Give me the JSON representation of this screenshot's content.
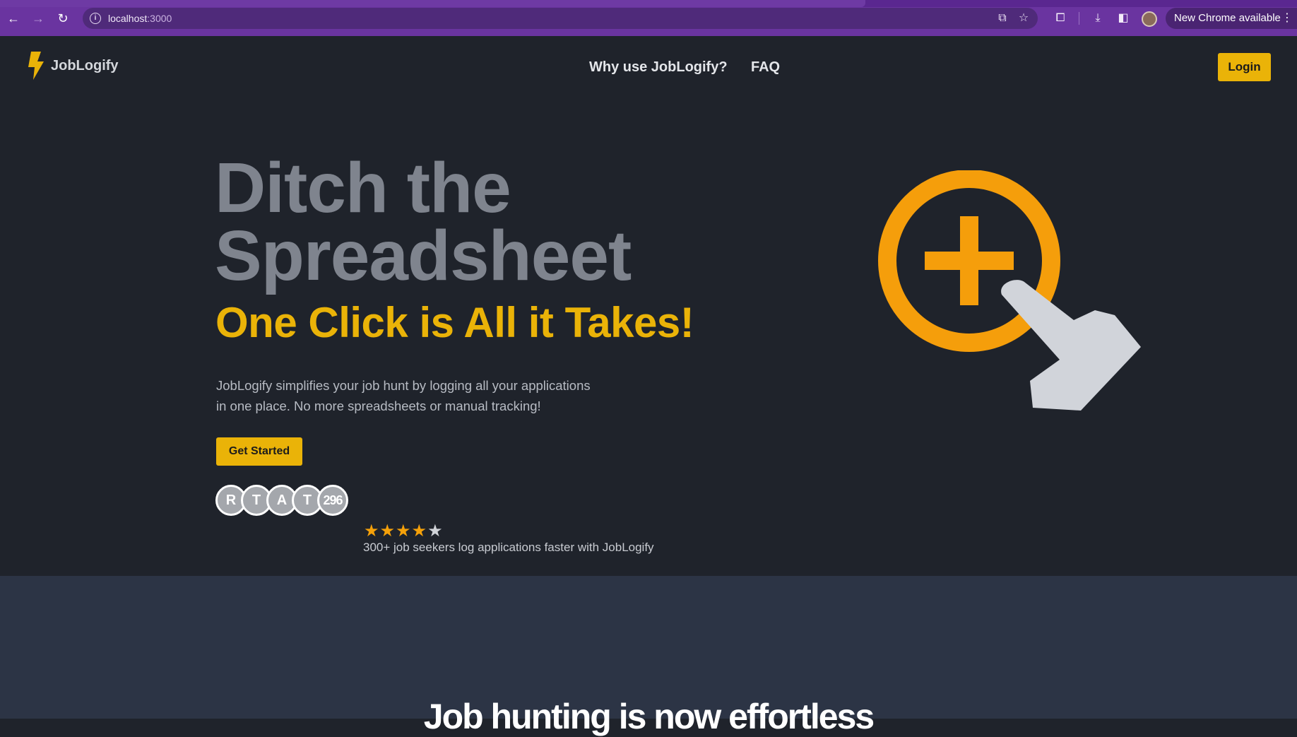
{
  "browser": {
    "url_host": "localhost",
    "url_port": ":3000",
    "update_label": "New Chrome available"
  },
  "header": {
    "brand": "JobLogify",
    "nav": [
      "Why use JobLogify?",
      "FAQ"
    ],
    "login_label": "Login"
  },
  "hero": {
    "title_line1": "Ditch the",
    "title_line2": "Spreadsheet",
    "subtitle": "One Click is All it Takes!",
    "description_line1": "JobLogify simplifies your job hunt by logging all your applications",
    "description_line2": "in one place. No more spreadsheets or manual tracking!",
    "cta_label": "Get Started",
    "avatars": [
      "R",
      "T",
      "A",
      "T"
    ],
    "avatar_count": "296",
    "rating": 4,
    "rating_max": 5,
    "social_proof": "300+ job seekers log applications faster with JobLogify"
  },
  "section2": {
    "title": "Job hunting is now effortless"
  },
  "colors": {
    "accent": "#eab308",
    "background": "#1f232b",
    "section_bg": "#2c3445",
    "browser_frame": "#6a34a0"
  },
  "icons": [
    "back-arrow-icon",
    "forward-arrow-icon",
    "reload-icon",
    "site-info-icon",
    "install-icon",
    "bookmark-star-icon",
    "extensions-icon",
    "download-icon",
    "side-panel-icon",
    "lightning-bolt-icon",
    "plus-circle-icon",
    "pointing-hand-icon",
    "star-icon"
  ]
}
